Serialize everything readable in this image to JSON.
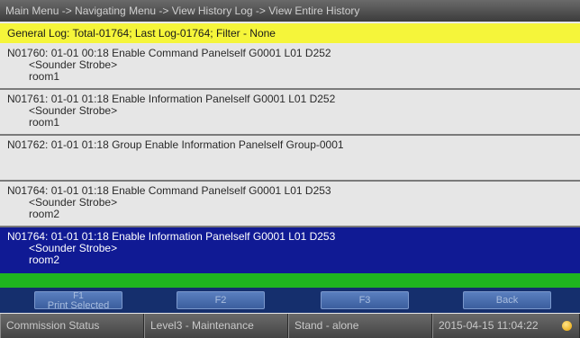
{
  "breadcrumb": "Main Menu -> Navigating Menu -> View History Log -> View Entire History",
  "summary": "General Log: Total-01764; Last Log-01764; Filter - None",
  "entries": [
    {
      "line": "N01760: 01-01 00:18 Enable Command Panelself G0001 L01 D252",
      "sub": "<Sounder Strobe>",
      "loc": "room1"
    },
    {
      "line": "N01761: 01-01 01:18 Enable Information Panelself G0001 L01 D252",
      "sub": "<Sounder Strobe>",
      "loc": "room1"
    },
    {
      "line": "N01762: 01-01 01:18 Group Enable Information Panelself Group-0001",
      "sub": "",
      "loc": ""
    },
    {
      "line": "N01764: 01-01 01:18 Enable Command Panelself G0001 L01 D253",
      "sub": "<Sounder Strobe>",
      "loc": "room2"
    },
    {
      "line": "N01764: 01-01 01:18 Enable Information Panelself G0001 L01 D253",
      "sub": "<Sounder Strobe>",
      "loc": "room2"
    }
  ],
  "buttons": {
    "f1_key": "F1",
    "f1_label": "Print Selected",
    "f2": "F2",
    "f3": "F3",
    "back": "Back"
  },
  "status": {
    "commission": "Commission Status",
    "level": "Level3 - Maintenance",
    "mode": "Stand - alone",
    "datetime": "2015-04-15 11:04:22"
  },
  "colors": {
    "summary_bg": "#f5f53a",
    "selected_bg": "#101a94",
    "status_green": "#1fb51f",
    "button_bar": "#152f6d"
  }
}
